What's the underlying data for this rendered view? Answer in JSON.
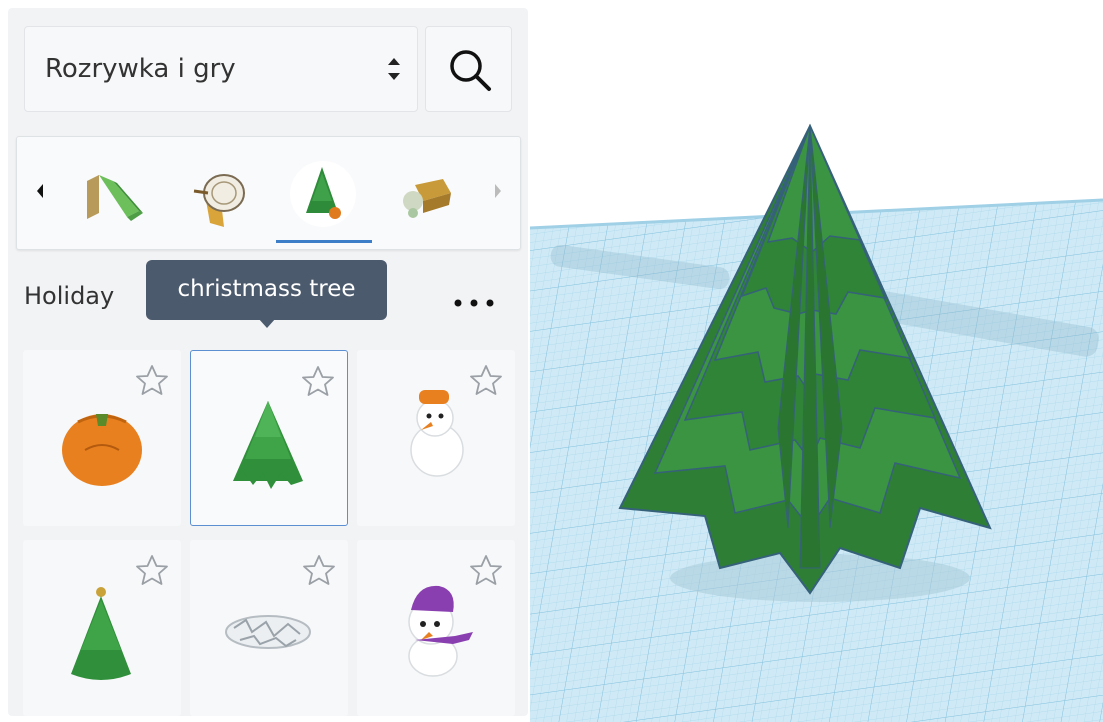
{
  "search": {
    "category_value": "Rozrywka i gry",
    "select_icon": "updown-chevron-icon",
    "button_icon": "search-icon"
  },
  "carousel": {
    "items": [
      {
        "icon": "slide-icon",
        "selected": false
      },
      {
        "icon": "drum-icon",
        "selected": false
      },
      {
        "icon": "holiday-tree-icon",
        "selected": true
      },
      {
        "icon": "treasure-icon",
        "selected": false
      }
    ]
  },
  "category": {
    "title": "Holiday",
    "more_icon": "more-dots-icon"
  },
  "tooltip": {
    "text": "christmass tree"
  },
  "shapes": [
    {
      "icon": "pumpkin-icon",
      "selected": false
    },
    {
      "icon": "christmas-tree-icon",
      "selected": true
    },
    {
      "icon": "snowman-orange-hat-icon",
      "selected": false
    },
    {
      "icon": "christmas-tree-star-icon",
      "selected": false
    },
    {
      "icon": "snowflakes-icon",
      "selected": false
    },
    {
      "icon": "snowman-purple-hat-icon",
      "selected": false
    }
  ],
  "colors": {
    "accent": "#3d7ec9",
    "tooltip_bg": "#4c5a6e",
    "tree_green": "#2e8b3a",
    "workplane_blue": "#cfeaf6"
  }
}
